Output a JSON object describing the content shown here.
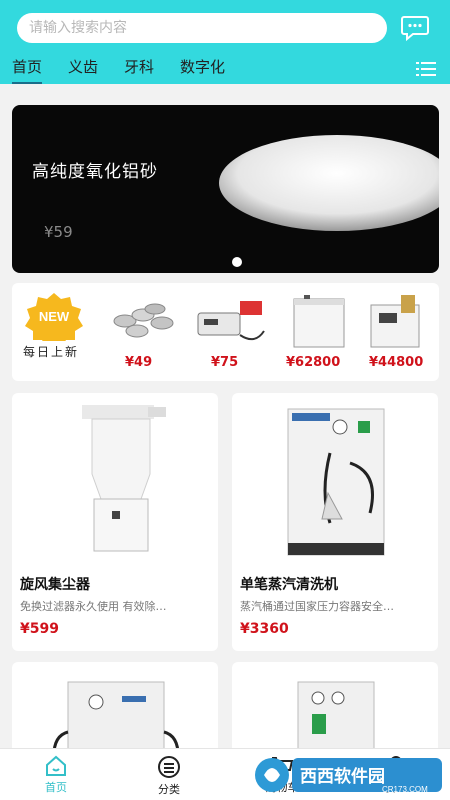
{
  "search": {
    "placeholder": "请输入搜索内容"
  },
  "tabs": [
    {
      "label": "首页",
      "active": true
    },
    {
      "label": "义齿"
    },
    {
      "label": "牙科"
    },
    {
      "label": "数字化"
    }
  ],
  "banner": {
    "title": "高纯度氧化铝砂",
    "price": "¥59"
  },
  "new_strip": {
    "badge": "NEW",
    "caption": "每日上新",
    "prices": [
      "¥49",
      "¥75",
      "¥62800",
      "¥44800"
    ]
  },
  "products": [
    {
      "title": "旋风集尘器",
      "desc": "免换过滤器永久使用 有效除…",
      "price": "¥599"
    },
    {
      "title": "单笔蒸汽清洗机",
      "desc": "蒸汽桶通过国家压力容器安全…",
      "price": "¥3360"
    }
  ],
  "tabbar": [
    {
      "label": "首页",
      "icon": "home-icon",
      "active": true
    },
    {
      "label": "分类",
      "icon": "category-icon"
    },
    {
      "label": "购物车",
      "icon": "cart-icon"
    },
    {
      "label": "我的",
      "icon": "user-icon"
    }
  ],
  "watermark": {
    "brand": "西西软件园",
    "domain": "CR173.COM"
  },
  "colors": {
    "header": "#33d9de",
    "price": "#d0121b",
    "tab_active": "#1a6e8a"
  }
}
